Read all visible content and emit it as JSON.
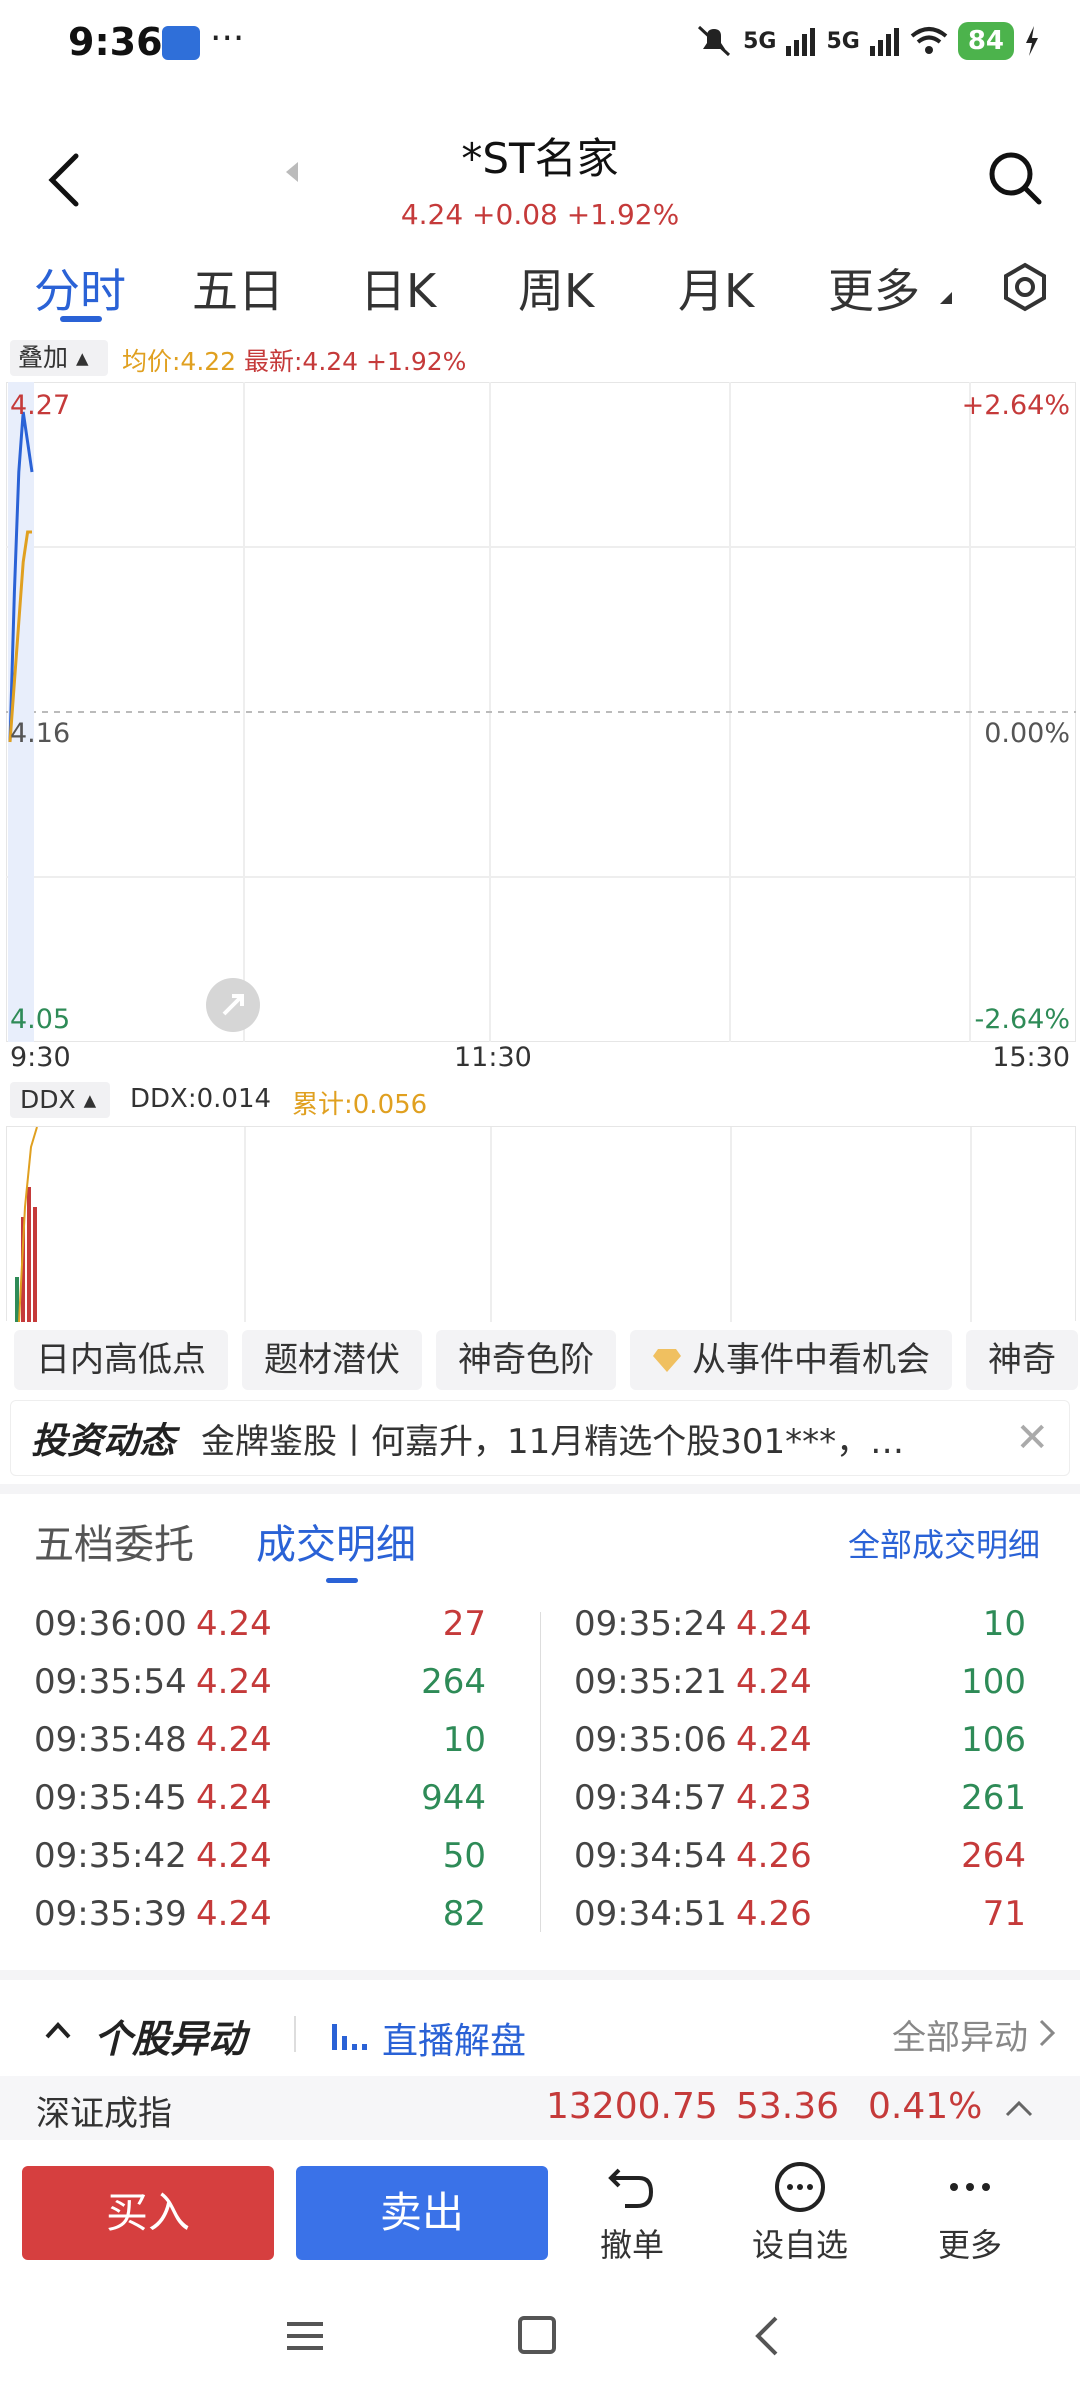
{
  "status_bar": {
    "time": "9:36",
    "more": "···",
    "net1": "5G",
    "net2": "5G",
    "battery": "84"
  },
  "header": {
    "title": "*ST名家",
    "subtitle": "4.24 +0.08 +1.92%"
  },
  "tabs": [
    "分时",
    "五日",
    "日K",
    "周K",
    "月K",
    "更多"
  ],
  "chart_bar": {
    "overlay": "叠加",
    "avg": "均价:4.22",
    "latest": "最新:4.24 +1.92%"
  },
  "chart_data": {
    "type": "line",
    "x_ticks": [
      "9:30",
      "11:30",
      "15:30"
    ],
    "y_left_ticks": [
      "4.27",
      "4.16",
      "4.05"
    ],
    "y_right_ticks": [
      "+2.64%",
      "0.00%",
      "-2.64%"
    ],
    "ylim": [
      4.05,
      4.27
    ],
    "series": [
      {
        "values": [
          4.15,
          4.2,
          4.24,
          4.26,
          4.25,
          4.24
        ]
      },
      {
        "values": [
          4.15,
          4.17,
          4.19,
          4.21,
          4.22,
          4.22
        ]
      }
    ],
    "colors": {
      "price": "#2a62d6",
      "avg": "#e0a020"
    }
  },
  "ddx": {
    "label": "DDX",
    "value": "DDX:0.014",
    "cumulative": "累计:0.056"
  },
  "chips": [
    "日内高低点",
    "题材潜伏",
    "神奇色阶",
    "从事件中看机会",
    "神奇"
  ],
  "news": {
    "label": "投资动态",
    "text": "金牌鉴股丨何嘉升，11月精选个股301***，…",
    "close": "✕"
  },
  "trade": {
    "tab1": "五档委托",
    "tab2": "成交明细",
    "all_link": "全部成交明细",
    "left_rows": [
      {
        "time": "09:36:00",
        "price": "4.24",
        "vol": "27",
        "dir": "red"
      },
      {
        "time": "09:35:54",
        "price": "4.24",
        "vol": "264",
        "dir": "green"
      },
      {
        "time": "09:35:48",
        "price": "4.24",
        "vol": "10",
        "dir": "green"
      },
      {
        "time": "09:35:45",
        "price": "4.24",
        "vol": "944",
        "dir": "green"
      },
      {
        "time": "09:35:42",
        "price": "4.24",
        "vol": "50",
        "dir": "green"
      },
      {
        "time": "09:35:39",
        "price": "4.24",
        "vol": "82",
        "dir": "green"
      }
    ],
    "right_rows": [
      {
        "time": "09:35:24",
        "price": "4.24",
        "vol": "10",
        "dir": "green"
      },
      {
        "time": "09:35:21",
        "price": "4.24",
        "vol": "100",
        "dir": "green"
      },
      {
        "time": "09:35:06",
        "price": "4.24",
        "vol": "106",
        "dir": "green"
      },
      {
        "time": "09:34:57",
        "price": "4.23",
        "vol": "261",
        "dir": "green"
      },
      {
        "time": "09:34:54",
        "price": "4.26",
        "vol": "264",
        "dir": "red"
      },
      {
        "time": "09:34:51",
        "price": "4.26",
        "vol": "71",
        "dir": "red"
      }
    ]
  },
  "abnormal": {
    "title": "个股异动",
    "live": "直播解盘",
    "all": "全部异动"
  },
  "index": {
    "name": "深证成指",
    "value": "13200.75",
    "change": "53.36",
    "pct": "0.41%"
  },
  "actions": {
    "buy": "买入",
    "sell": "卖出",
    "cancel": "撤单",
    "watch": "设自选",
    "more": "更多"
  }
}
